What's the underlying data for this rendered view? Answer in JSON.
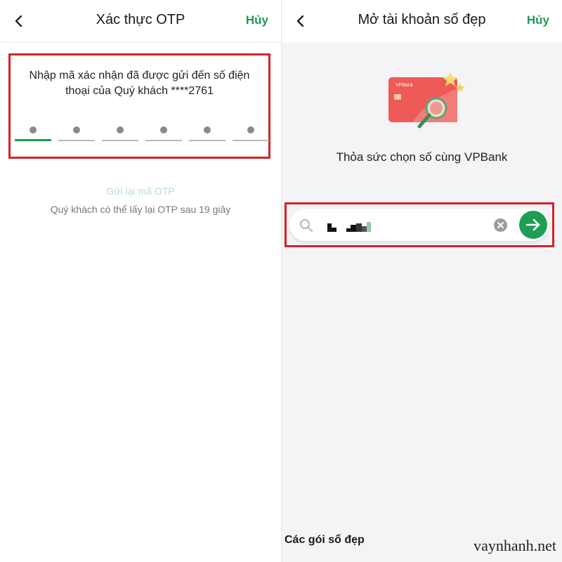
{
  "left": {
    "header": {
      "title": "Xác thực OTP",
      "cancel_label": "Hủy"
    },
    "otp": {
      "message_line1": "Nhập mã xác nhận đã được gửi đến số điện",
      "message_line2": "thoại của Quý khách ****2761",
      "slot_count": 6,
      "active_slot": 1
    },
    "resend_label": "Gửi lại mã OTP",
    "countdown_text": "Quý khách có thể lấy lại OTP sau 19 giây"
  },
  "right": {
    "header": {
      "title": "Mở tài khoản số đẹp",
      "cancel_label": "Hủy"
    },
    "illustration": {
      "card_brand": "VPBank"
    },
    "tagline": "Thỏa sức chọn số cùng VPBank",
    "search": {
      "value_note": "pixelated"
    },
    "packages_title": "Các gói số đẹp"
  },
  "watermark": "vaynhanh.net",
  "colors": {
    "accent_green": "#1f9a53",
    "highlight_red": "#d2232a",
    "card_red": "#ee5a57"
  }
}
